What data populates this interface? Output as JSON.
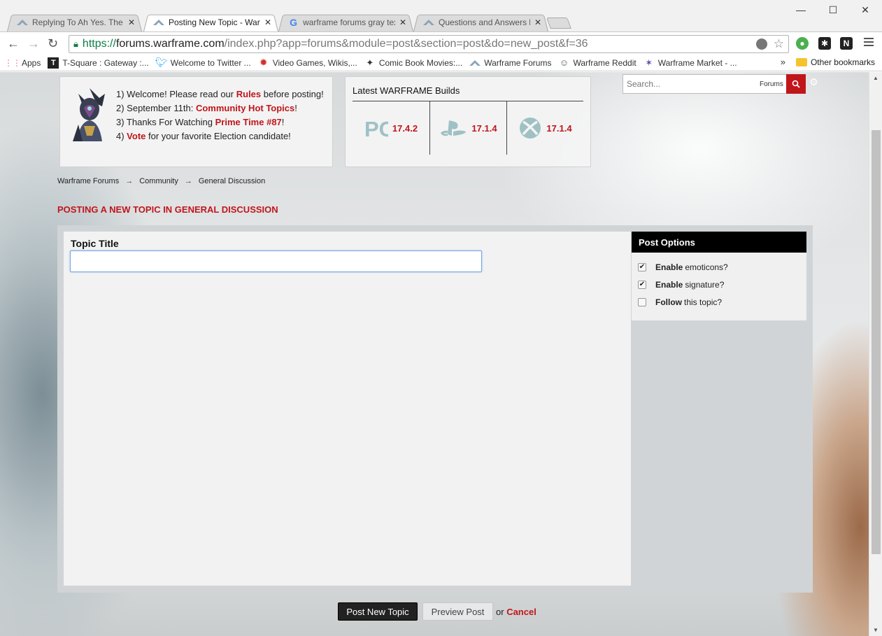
{
  "browser": {
    "tabs": [
      {
        "title": "Replying To Ah Yes. The Fr",
        "active": false
      },
      {
        "title": "Posting New Topic - Warfr",
        "active": true
      },
      {
        "title": "warframe forums gray tex",
        "active": false
      },
      {
        "title": "Questions and Answers bu",
        "active": false
      }
    ],
    "url": {
      "scheme": "https://",
      "host": "forums.warframe.com",
      "rest": "/index.php?app=forums&module=post&section=post&do=new_post&f=36"
    },
    "bookmarks": [
      {
        "label": "Apps",
        "icon": "apps-grid-icon"
      },
      {
        "label": "T-Square : Gateway :...",
        "icon": "tsquare-icon"
      },
      {
        "label": "Welcome to Twitter ...",
        "icon": "twitter-bird-icon"
      },
      {
        "label": "Video Games, Wikis,...",
        "icon": "wikia-icon"
      },
      {
        "label": "Comic Book Movies:...",
        "icon": "comic-icon"
      },
      {
        "label": "Warframe Forums",
        "icon": "warframe-icon"
      },
      {
        "label": "Warframe Reddit",
        "icon": "reddit-icon"
      },
      {
        "label": "Warframe Market - ...",
        "icon": "market-icon"
      }
    ],
    "other_bookmarks": "Other bookmarks",
    "overflow": "»"
  },
  "header": {
    "announcements": [
      {
        "pre": "1) Welcome! Please read our ",
        "link": "Rules",
        "post": " before posting!"
      },
      {
        "pre": "2) September 11th: ",
        "link": "Community Hot Topics",
        "post": "!"
      },
      {
        "pre": "3) Thanks For Watching ",
        "link": "Prime Time #87",
        "post": "!"
      },
      {
        "pre": "4) ",
        "link": "Vote",
        "post": " for your favorite Election candidate!"
      }
    ],
    "builds": {
      "title": "Latest WARFRAME Builds",
      "platforms": [
        {
          "platform": "PC",
          "version": "17.4.2"
        },
        {
          "platform": "PlayStation",
          "version": "17.1.4"
        },
        {
          "platform": "Xbox",
          "version": "17.1.4"
        }
      ]
    },
    "search": {
      "placeholder": "Search...",
      "scope": "Forums"
    }
  },
  "breadcrumb": [
    "Warframe Forums",
    "Community",
    "General Discussion"
  ],
  "page_title": "POSTING A NEW TOPIC IN GENERAL DISCUSSION",
  "form": {
    "topic_label": "Topic Title",
    "topic_value": ""
  },
  "post_options": {
    "header": "Post Options",
    "items": [
      {
        "bold": "Enable",
        "rest": " emoticons?",
        "checked": true
      },
      {
        "bold": "Enable",
        "rest": " signature?",
        "checked": true
      },
      {
        "bold": "Follow",
        "rest": " this topic?",
        "checked": false
      }
    ]
  },
  "actions": {
    "post": "Post New Topic",
    "preview": "Preview Post",
    "or": "or",
    "cancel": "Cancel"
  },
  "colors": {
    "accent": "#c0161b",
    "builds_icon": "#9fc1c4"
  }
}
